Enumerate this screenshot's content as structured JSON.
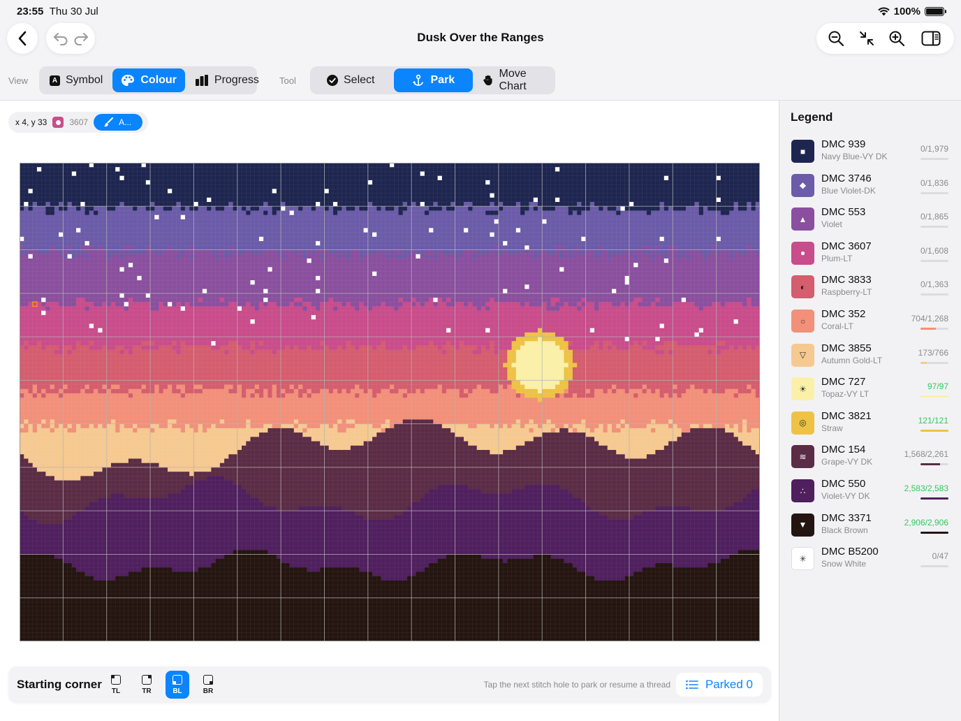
{
  "status": {
    "time": "23:55",
    "date": "Thu 30 Jul",
    "battery": "100%"
  },
  "title": "Dusk Over the Ranges",
  "toolbar": {
    "view_label": "View",
    "view": [
      {
        "label": "Symbol",
        "icon": "symbol-icon",
        "active": false
      },
      {
        "label": "Colour",
        "icon": "palette-icon",
        "active": true
      },
      {
        "label": "Progress",
        "icon": "bar-chart-icon",
        "active": false
      }
    ],
    "tool_label": "Tool",
    "tool": [
      {
        "label": "Select",
        "icon": "checkmark-circle-icon",
        "active": false
      },
      {
        "label": "Park",
        "icon": "anchor-icon",
        "active": true
      },
      {
        "label": "Move Chart",
        "icon": "hand-icon",
        "active": false
      }
    ]
  },
  "info": {
    "coords": "x 4, y 33",
    "code": "3607",
    "action": "A...",
    "swatch_color": "#c94c8b"
  },
  "bottom": {
    "starting_corner": "Starting corner",
    "corners": [
      "TL",
      "TR",
      "BL",
      "BR"
    ],
    "selected": "BL",
    "hint": "Tap the next stitch hole to park or resume a thread",
    "parked": "Parked 0"
  },
  "legend": {
    "title": "Legend",
    "items": [
      {
        "name": "DMC 939",
        "sub": "Navy Blue-VY DK",
        "count": "0/1,979",
        "color": "#1e2650",
        "symbol": "■",
        "sym_color": "#ffffff",
        "progress": 0,
        "complete": false
      },
      {
        "name": "DMC 3746",
        "sub": "Blue Violet-DK",
        "count": "0/1,836",
        "color": "#6b5ba8",
        "symbol": "◆",
        "sym_color": "#ffffff",
        "progress": 0,
        "complete": false
      },
      {
        "name": "DMC 553",
        "sub": "Violet",
        "count": "0/1,865",
        "color": "#8a4f9e",
        "symbol": "▲",
        "sym_color": "#ffffff",
        "progress": 0,
        "complete": false
      },
      {
        "name": "DMC 3607",
        "sub": "Plum-LT",
        "count": "0/1,608",
        "color": "#c94c8b",
        "symbol": "●",
        "sym_color": "#ffffff",
        "progress": 0,
        "complete": false
      },
      {
        "name": "DMC 3833",
        "sub": "Raspberry-LT",
        "count": "0/1,363",
        "color": "#d45d6e",
        "symbol": "◐",
        "sym_color": "#111111",
        "progress": 0,
        "complete": false
      },
      {
        "name": "DMC 352",
        "sub": "Coral-LT",
        "count": "704/1,268",
        "color": "#f2907a",
        "symbol": "○",
        "sym_color": "#333333",
        "progress": 0.555,
        "complete": false
      },
      {
        "name": "DMC 3855",
        "sub": "Autumn Gold-LT",
        "count": "173/766",
        "color": "#f6c991",
        "symbol": "▽",
        "sym_color": "#333333",
        "progress": 0.226,
        "complete": false
      },
      {
        "name": "DMC 727",
        "sub": "Topaz-VY LT",
        "count": "97/97",
        "color": "#fbf0a8",
        "symbol": "☀",
        "sym_color": "#333333",
        "progress": 1,
        "complete": true
      },
      {
        "name": "DMC 3821",
        "sub": "Straw",
        "count": "121/121",
        "color": "#eec245",
        "symbol": "◎",
        "sym_color": "#333333",
        "progress": 1,
        "complete": true
      },
      {
        "name": "DMC 154",
        "sub": "Grape-VY DK",
        "count": "1,568/2,261",
        "color": "#5b2c45",
        "symbol": "≋",
        "sym_color": "#ffffff",
        "progress": 0.693,
        "complete": false
      },
      {
        "name": "DMC 550",
        "sub": "Violet-VY DK",
        "count": "2,583/2,583",
        "color": "#4f1f5e",
        "symbol": "∴",
        "sym_color": "#ffffff",
        "progress": 1,
        "complete": true
      },
      {
        "name": "DMC 3371",
        "sub": "Black Brown",
        "count": "2,906/2,906",
        "color": "#241510",
        "symbol": "▼",
        "sym_color": "#ffffff",
        "progress": 1,
        "complete": true
      },
      {
        "name": "DMC B5200",
        "sub": "Snow White",
        "count": "0/47",
        "color": "#ffffff",
        "symbol": "✳",
        "sym_color": "#333333",
        "progress": 0,
        "complete": false
      }
    ]
  }
}
